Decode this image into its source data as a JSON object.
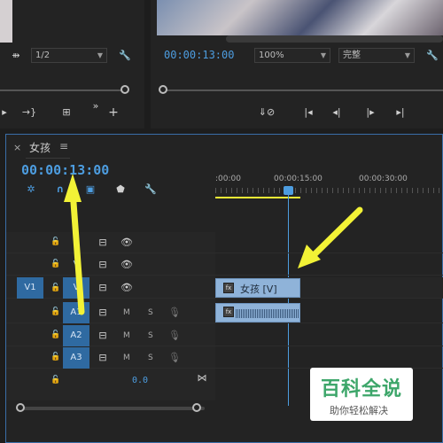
{
  "source_monitor": {
    "scale_value": "1/2",
    "icons": [
      "markers-icon",
      "wrench-icon",
      "step-icon",
      "insert-icon",
      "overwrite-icon",
      "more-icon",
      "add-icon"
    ]
  },
  "program_monitor": {
    "timecode": "00:00:13:00",
    "zoom_value": "100%",
    "quality_value": "完整",
    "icons": [
      "wrench-icon",
      "lift-icon",
      "extract-icon",
      "prev-edit-icon",
      "step-back-icon",
      "play-icon",
      "next-edit-icon"
    ]
  },
  "timeline": {
    "tab_close": "×",
    "tab_title": "女孩",
    "tab_menu": "≡",
    "timecode": "00:00:13:00",
    "ruler_labels": [
      ":00:00",
      "00:00:15:00",
      "00:00:30:00"
    ],
    "tracks": [
      {
        "source": "",
        "name": "V",
        "type": "video"
      },
      {
        "source": "",
        "name": "V",
        "type": "video"
      },
      {
        "source": "V1",
        "name": "V",
        "type": "video"
      },
      {
        "source": "",
        "name": "A1",
        "type": "audio",
        "m": "M",
        "s": "S"
      },
      {
        "source": "",
        "name": "A2",
        "type": "audio",
        "m": "M",
        "s": "S"
      },
      {
        "source": "",
        "name": "A3",
        "type": "audio",
        "m": "M",
        "s": "S"
      }
    ],
    "master_value": "0.0",
    "video_clip_label": "女孩 [V]"
  },
  "watermark": {
    "title": "百科全说",
    "subtitle": "助你轻松解决"
  },
  "colors": {
    "accent": "#4d9de0",
    "arrow": "#f2f236",
    "clip": "#8fb3d9"
  }
}
